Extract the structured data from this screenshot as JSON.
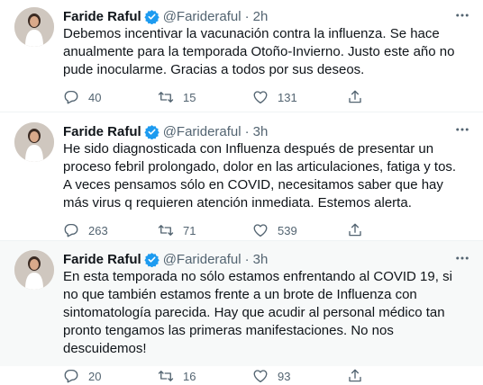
{
  "tweets": [
    {
      "name": "Faride Raful",
      "handle": "@Farideraful",
      "separator": "·",
      "time": "2h",
      "text": "Debemos incentivar la vacunación contra la influenza. Se hace anualmente para la temporada Otoño-Invierno. Justo este año no pude inocularme. Gracias a todos por sus deseos.",
      "replies": "40",
      "retweets": "15",
      "likes": "131"
    },
    {
      "name": "Faride Raful",
      "handle": "@Farideraful",
      "separator": "·",
      "time": "3h",
      "text": "He sido diagnosticada con Influenza después de presentar un proceso febril prolongado, dolor en las articulaciones, fatiga y tos. A veces pensamos sólo en COVID, necesitamos saber que hay más virus q requieren atención inmediata. Estemos alerta.",
      "replies": "263",
      "retweets": "71",
      "likes": "539"
    },
    {
      "name": "Faride Raful",
      "handle": "@Farideraful",
      "separator": "·",
      "time": "3h",
      "text": "En esta temporada no sólo estamos enfrentando al COVID 19, si no que también estamos frente a un brote de Influenza con sintomatología parecida. Hay que acudir al personal médico tan pronto tengamos las primeras manifestaciones. No nos descuidemos!",
      "replies": "20",
      "retweets": "16",
      "likes": "93"
    }
  ],
  "icons": {
    "verified": "verified-badge-icon",
    "more": "more-options-icon",
    "reply": "reply-icon",
    "retweet": "retweet-icon",
    "like": "like-icon",
    "share": "share-icon"
  },
  "colors": {
    "accent": "#1d9bf0",
    "secondary_text": "#536471",
    "hover_background": "#f7f9f9"
  }
}
